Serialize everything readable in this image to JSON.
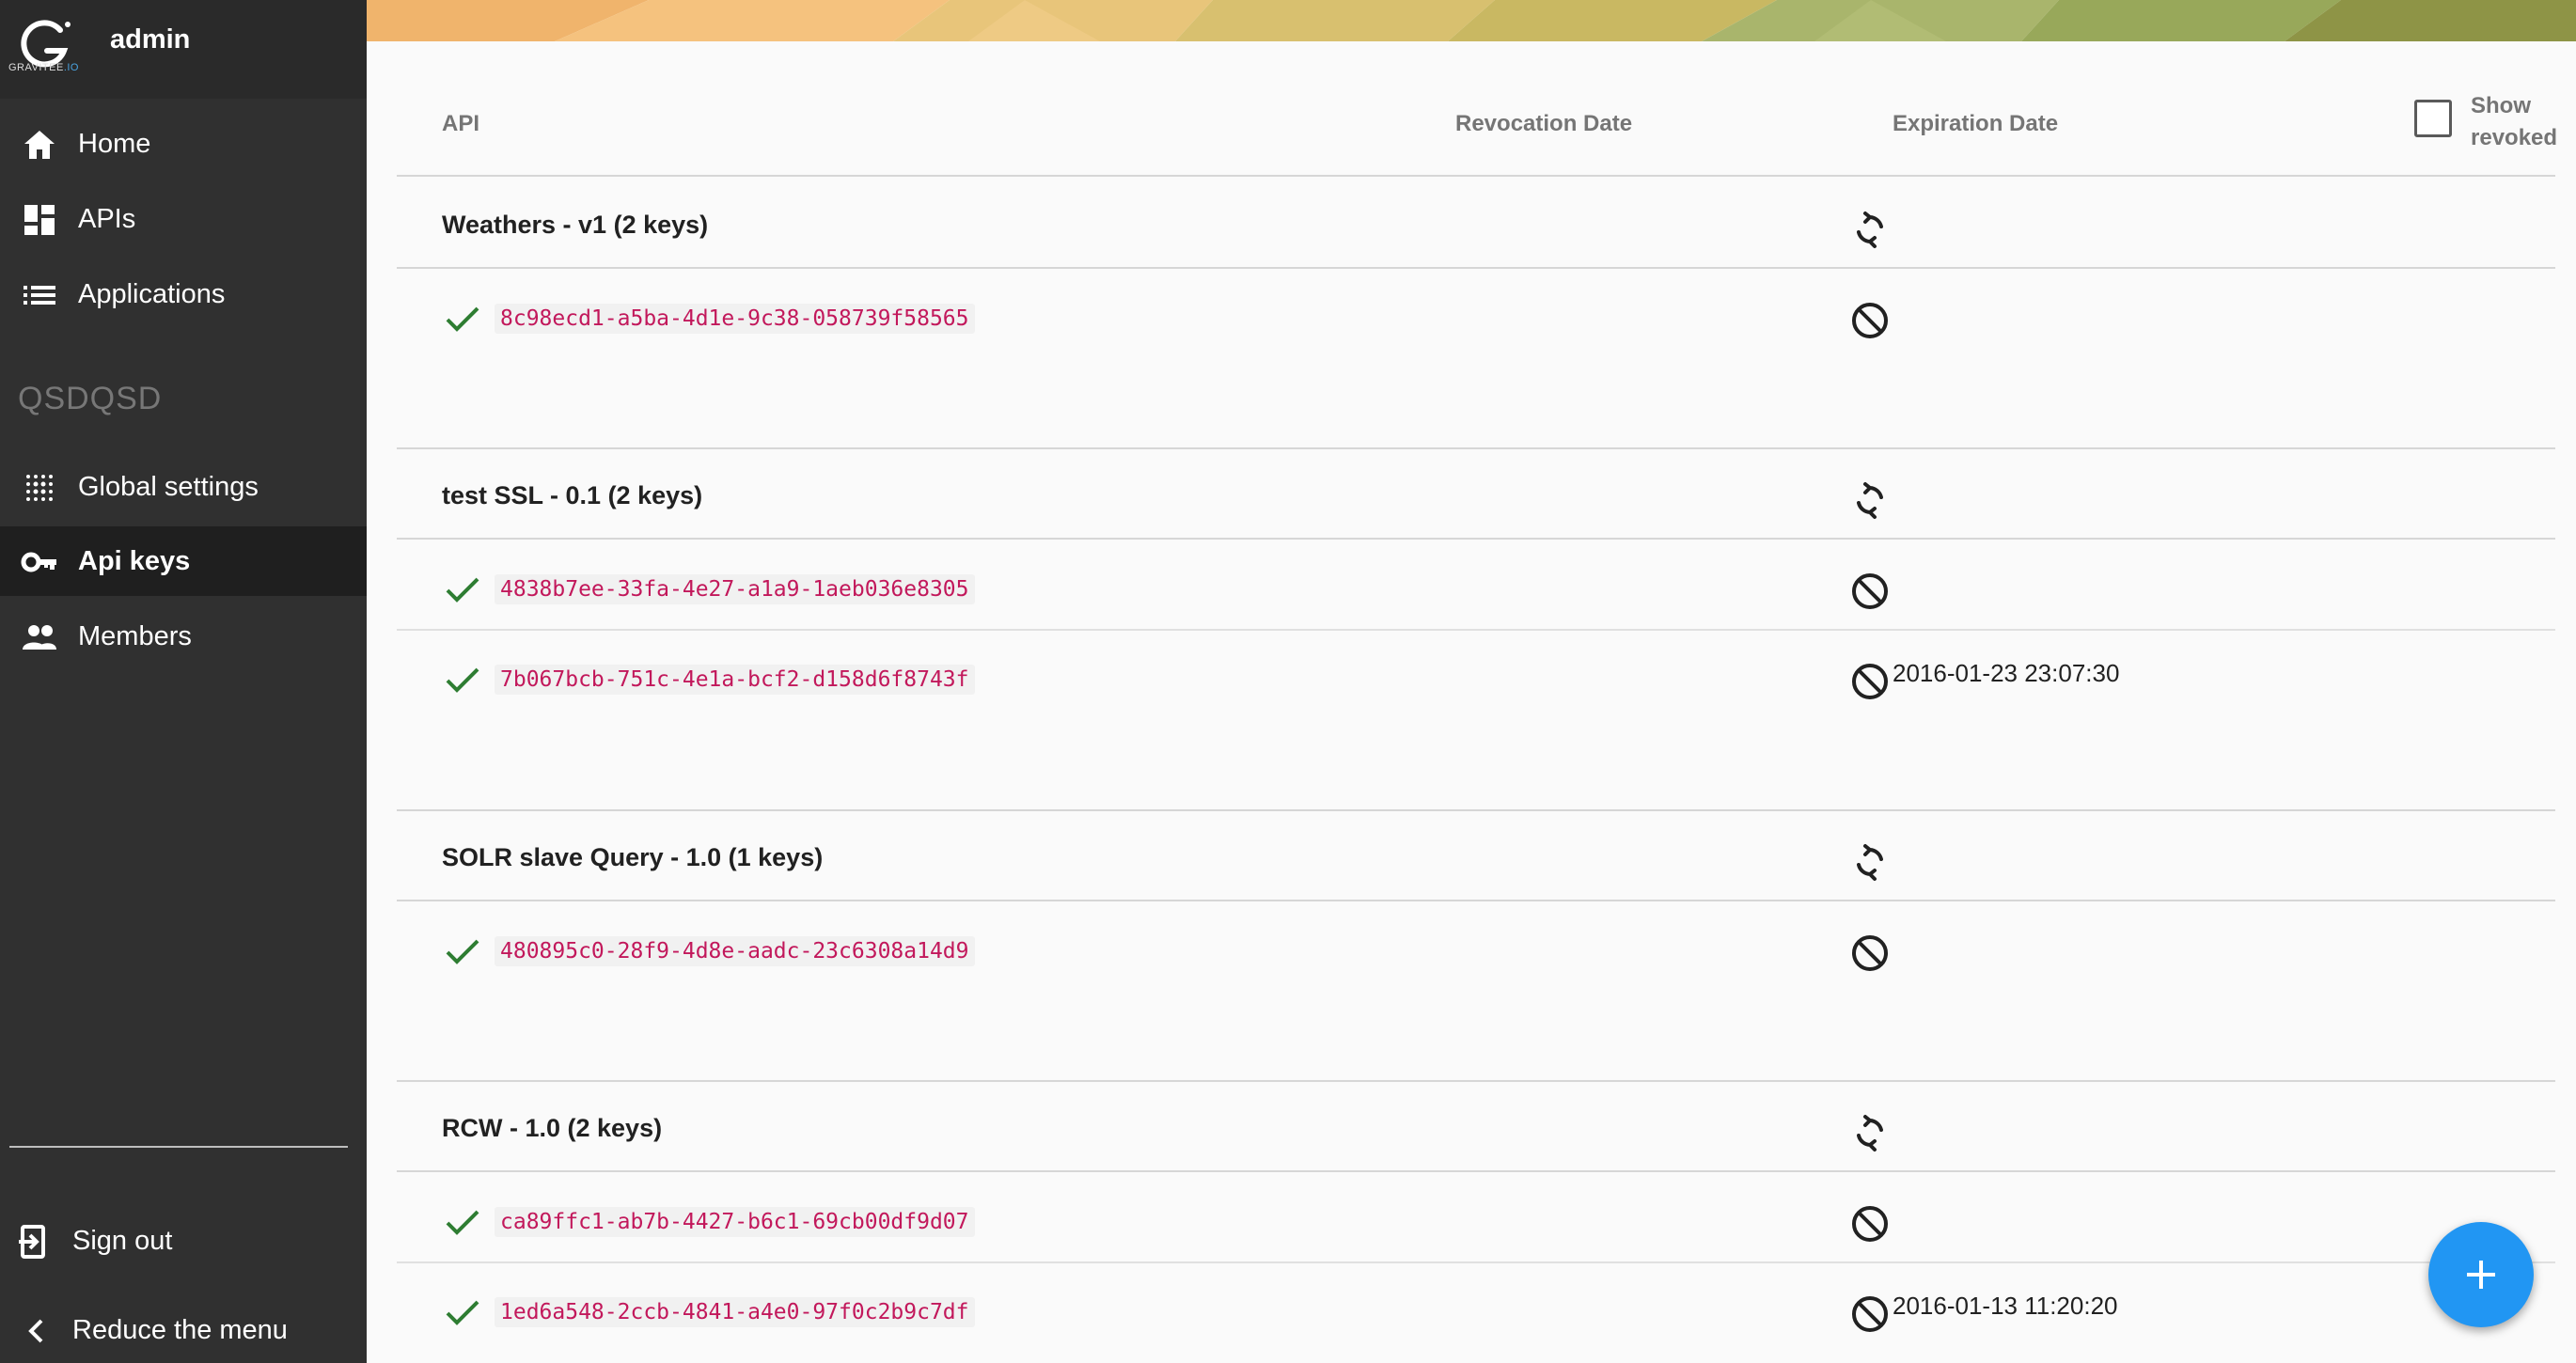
{
  "sidebar": {
    "logo_text": "GRAVITEE",
    "logo_text_suffix": ".IO",
    "username": "admin",
    "items": [
      {
        "label": "Home",
        "icon": "home-icon"
      },
      {
        "label": "APIs",
        "icon": "dashboard-icon"
      },
      {
        "label": "Applications",
        "icon": "list-icon"
      }
    ],
    "section_title": "QSDQSD",
    "section_items": [
      {
        "label": "Global settings",
        "icon": "dots-grid-icon"
      },
      {
        "label": "Api keys",
        "icon": "key-icon",
        "active": true
      },
      {
        "label": "Members",
        "icon": "group-icon"
      }
    ],
    "sign_out": "Sign out",
    "reduce_menu": "Reduce the menu"
  },
  "table": {
    "headers": {
      "api": "API",
      "revocation_date": "Revocation Date",
      "expiration_date": "Expiration Date",
      "show_revoked": "Show revoked"
    },
    "show_revoked_checked": false,
    "groups": [
      {
        "name": "Weathers - v1 (2 keys)",
        "keys": [
          {
            "key": "8c98ecd1-a5ba-4d1e-9c38-058739f58565",
            "expiration": ""
          }
        ]
      },
      {
        "name": "test SSL - 0.1 (2 keys)",
        "keys": [
          {
            "key": "4838b7ee-33fa-4e27-a1a9-1aeb036e8305",
            "expiration": ""
          },
          {
            "key": "7b067bcb-751c-4e1a-bcf2-d158d6f8743f",
            "expiration": "2016-01-23 23:07:30"
          }
        ]
      },
      {
        "name": "SOLR slave Query - 1.0 (1 keys)",
        "keys": [
          {
            "key": "480895c0-28f9-4d8e-aadc-23c6308a14d9",
            "expiration": ""
          }
        ]
      },
      {
        "name": "RCW - 1.0 (2 keys)",
        "keys": [
          {
            "key": "ca89ffc1-ab7b-4427-b6c1-69cb00df9d07",
            "expiration": ""
          },
          {
            "key": "1ed6a548-2ccb-4841-a4e0-97f0c2b9c7df",
            "expiration": "2016-01-13 11:20:20"
          }
        ]
      }
    ]
  },
  "colors": {
    "sidebar_bg": "#303030",
    "active_bg": "#1f1f1f",
    "key_text": "#c2185b",
    "check_green": "#2e7d32",
    "fab_blue": "#2196f3"
  }
}
